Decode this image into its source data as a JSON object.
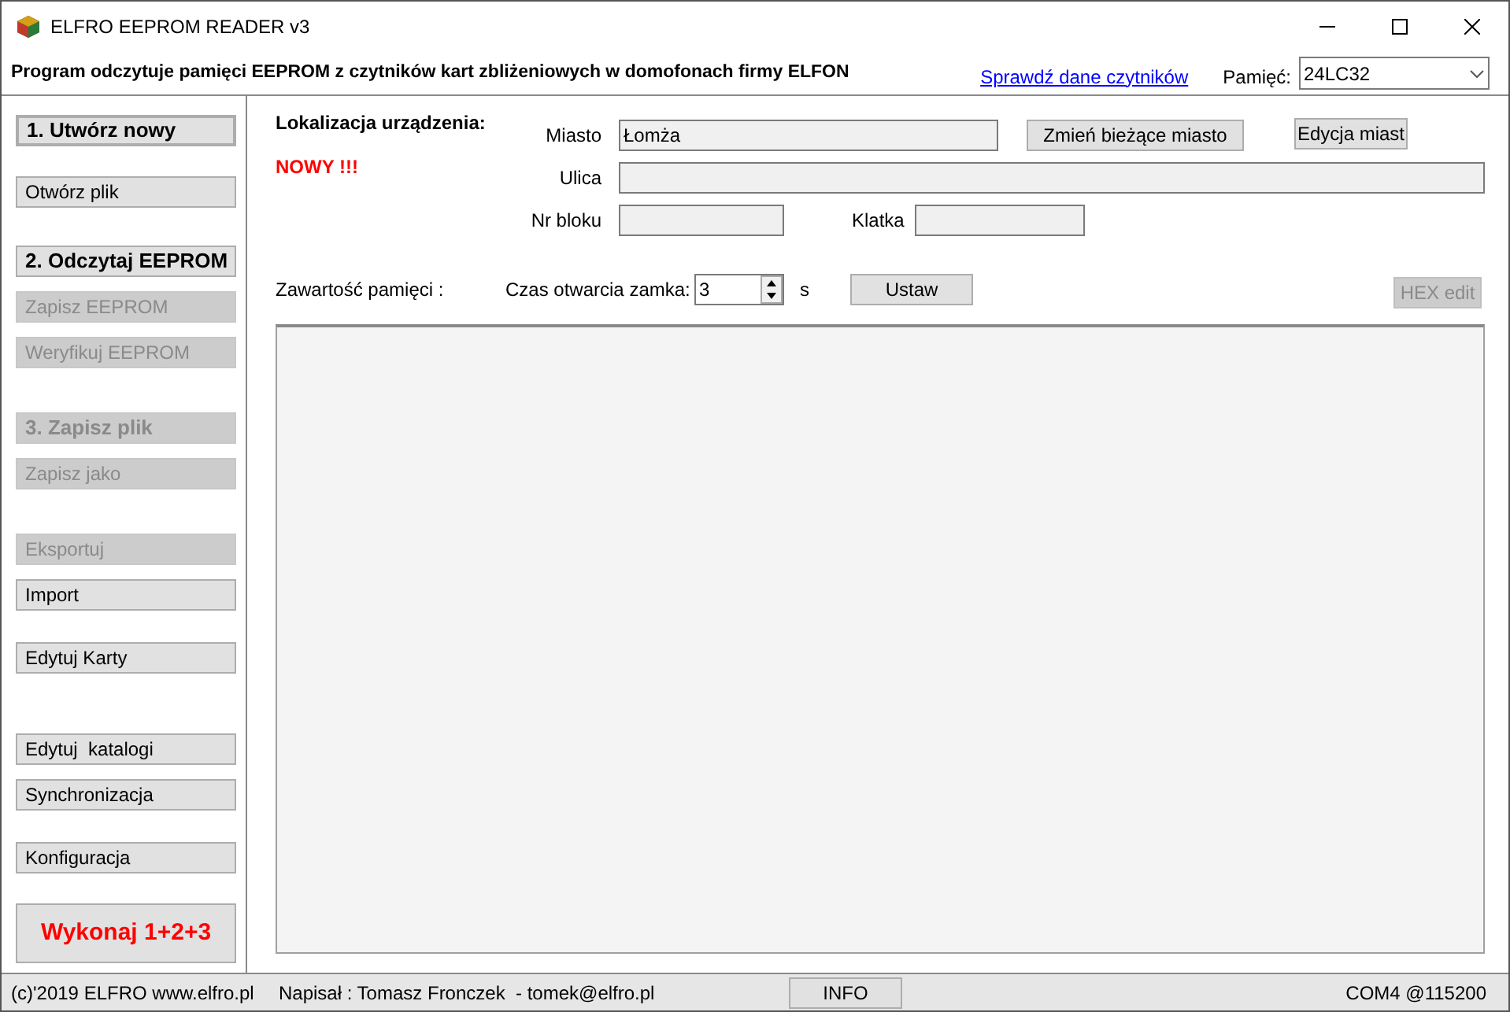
{
  "window": {
    "title": "ELFRO EEPROM READER v3"
  },
  "header": {
    "description": "Program odczytuje pamięci EEPROM z czytników kart zbliżeniowych w domofonach firmy ELFON",
    "link": "Sprawdź dane czytników",
    "memory_label": "Pamięć:",
    "memory_value": "24LC32"
  },
  "sidebar": {
    "groups": [
      [
        {
          "label": "1. Utwórz nowy",
          "kind": "step",
          "disabled": false,
          "focused": true
        }
      ],
      [
        {
          "label": "Otwórz plik",
          "kind": "normal",
          "disabled": false,
          "focused": false
        }
      ],
      [
        {
          "label": "2. Odczytaj EEPROM",
          "kind": "step",
          "disabled": false,
          "focused": false
        },
        {
          "label": "Zapisz EEPROM",
          "kind": "normal",
          "disabled": true,
          "focused": false
        },
        {
          "label": "Weryfikuj EEPROM",
          "kind": "normal",
          "disabled": true,
          "focused": false
        }
      ],
      [
        {
          "label": "3. Zapisz plik",
          "kind": "step",
          "disabled": true,
          "focused": false
        },
        {
          "label": "Zapisz jako",
          "kind": "normal",
          "disabled": true,
          "focused": false
        }
      ],
      [
        {
          "label": "Eksportuj",
          "kind": "normal",
          "disabled": true,
          "focused": false
        },
        {
          "label": "Import",
          "kind": "normal",
          "disabled": false,
          "focused": false
        }
      ],
      [
        {
          "label": "Edytuj Karty",
          "kind": "normal",
          "disabled": false,
          "focused": false
        }
      ],
      [
        {
          "label": "Edytuj  katalogi",
          "kind": "normal",
          "disabled": false,
          "focused": false
        },
        {
          "label": "Synchronizacja",
          "kind": "normal",
          "disabled": false,
          "focused": false
        }
      ],
      [
        {
          "label": "Konfiguracja",
          "kind": "normal",
          "disabled": false,
          "focused": false
        }
      ],
      [
        {
          "label": "Wykonaj 1+2+3",
          "kind": "action",
          "disabled": false,
          "focused": false
        }
      ]
    ]
  },
  "location": {
    "title": "Lokalizacja urządzenia:",
    "badge": "NOWY !!!",
    "city_label": "Miasto",
    "city_value": "Łomża",
    "change_city_button": "Zmień bieżące miasto",
    "edit_cities_button": "Edycja miast",
    "street_label": "Ulica",
    "block_label": "Nr bloku",
    "staircase_label": "Klatka"
  },
  "memory": {
    "label": "Zawartość pamięci :",
    "lock_time_label": "Czas otwarcia zamka:",
    "lock_time_value": "3",
    "unit": "s",
    "set_button": "Ustaw",
    "hex_edit_button": "HEX edit",
    "hex_edit_disabled": true
  },
  "status_bar": {
    "copyright": "(c)'2019 ELFRO www.elfro.pl",
    "author": "Napisał : Tomasz Fronczek  - tomek@elfro.pl",
    "info_button": "INFO",
    "port": "COM4 @115200"
  }
}
